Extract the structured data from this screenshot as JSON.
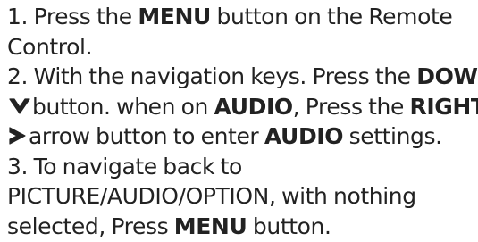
{
  "colors": {
    "text": "#222222",
    "background": "#ffffff"
  },
  "steps": [
    {
      "lines": [
        {
          "a": "1. Press the ",
          "kw1": "MENU",
          "b": " button on the Remote"
        },
        {
          "a": "Control."
        }
      ]
    },
    {
      "lines": [
        {
          "a": "2. With the navigation keys. Press the ",
          "kw1": "DOWN"
        },
        {
          "icon": "chevron-down-icon",
          "a": "button. when on ",
          "kw1": "AUDIO",
          "b": ", Press the ",
          "kw2": "RIGHT"
        },
        {
          "icon": "chevron-right-icon",
          "a": "arrow button to enter ",
          "kw1": "AUDIO",
          "b": " settings."
        }
      ]
    },
    {
      "lines": [
        {
          "a": "3. To navigate back to"
        },
        {
          "a": "PICTURE/AUDIO/OPTION, with nothing"
        },
        {
          "a": "selected, Press ",
          "kw1": "MENU",
          "b": " button."
        }
      ]
    }
  ]
}
